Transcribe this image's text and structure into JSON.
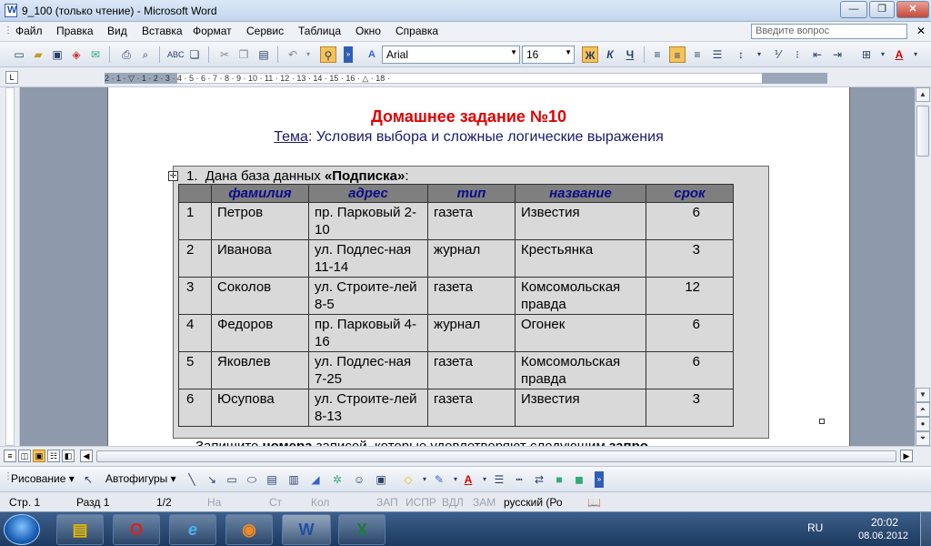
{
  "window": {
    "title": "9_100 (только чтение) - Microsoft Word"
  },
  "menu": {
    "items": [
      "Файл",
      "Правка",
      "Вид",
      "Вставка",
      "Формат",
      "Сервис",
      "Таблица",
      "Окно",
      "Справка"
    ],
    "ask_placeholder": "Введите вопрос"
  },
  "toolbar": {
    "font": "Arial",
    "size": "16",
    "bold": "Ж",
    "italic": "К",
    "underline": "Ч",
    "color_letter": "A"
  },
  "ruler": {
    "numbers": "2 · 1 · ▽ · 1 · 2 · 3 · 4 · 5 · 6 · 7 · 8 · 9 · 10 · 11 · 12 · 13 · 14 · 15 · 16 · △ · 18 ·"
  },
  "doc": {
    "title": "Домашнее задание №10",
    "subtitle_label": "Тема",
    "subtitle_rest": ": Условия выбора и сложные логические выражения",
    "task_num": "1.",
    "task_text": "Дана база данных ",
    "task_db": "«Подписка»",
    "task_colon": ":",
    "columns": [
      "",
      "фамилия",
      "адрес",
      "тип",
      "название",
      "срок"
    ],
    "rows": [
      {
        "n": "1",
        "surname": "Петров",
        "address": "пр. Парковый 2-10",
        "type": "газета",
        "name": "Известия",
        "term": "6"
      },
      {
        "n": "2",
        "surname": "Иванова",
        "address": "ул. Подлес-ная 11-14",
        "type": "журнал",
        "name": "Крестьянка",
        "term": "3"
      },
      {
        "n": "3",
        "surname": "Соколов",
        "address": "ул. Строите-лей 8-5",
        "type": "газета",
        "name": "Комсомольская правда",
        "term": "12"
      },
      {
        "n": "4",
        "surname": "Федоров",
        "address": "пр. Парковый 4-16",
        "type": "журнал",
        "name": "Огонек",
        "term": "6"
      },
      {
        "n": "5",
        "surname": "Яковлев",
        "address": "ул. Подлес-ная 7-25",
        "type": "газета",
        "name": "Комсомольская правда",
        "term": "6"
      },
      {
        "n": "6",
        "surname": "Юсупова",
        "address": "ул. Строите-лей 8-13",
        "type": "газета",
        "name": "Известия",
        "term": "3"
      }
    ],
    "bottom_a": "Запишите ",
    "bottom_b": "номера",
    "bottom_c": " записей, которые удовлетворяют следующим ",
    "bottom_d": "запро-"
  },
  "drawbar": {
    "draw": "Рисование",
    "autoshapes": "Автофигуры"
  },
  "status": {
    "page": "Стр.  1",
    "section": "Разд  1",
    "pages": "1/2",
    "at": "На",
    "ln": "Ст",
    "col": "Кол",
    "rec": "ЗАП",
    "trk": "ИСПР",
    "ext": "ВДЛ",
    "ovr": "ЗАМ",
    "lang": "русский (Ро"
  },
  "taskbar": {
    "lang": "RU",
    "time": "20:02",
    "date": "08.06.2012"
  },
  "colors": {
    "title_red": "#e00000",
    "header_blue": "#0b0b8a",
    "table_bg": "#d9d9d9"
  }
}
